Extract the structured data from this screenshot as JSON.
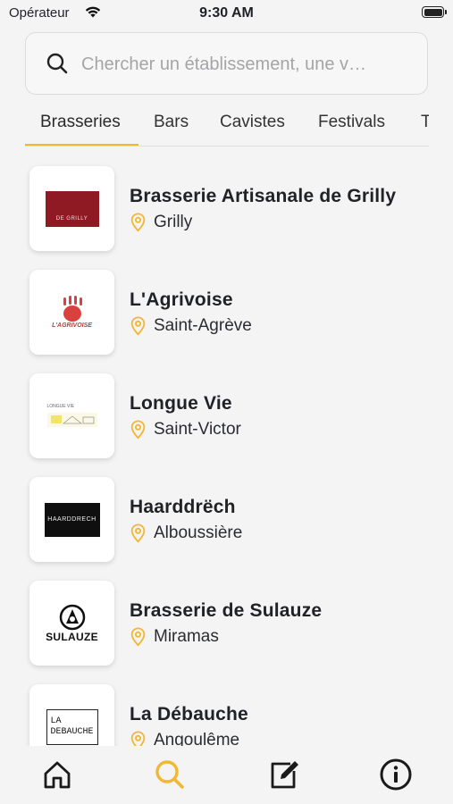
{
  "status": {
    "carrier": "Opérateur",
    "time": "9:30 AM"
  },
  "search": {
    "placeholder": "Chercher un établissement, une v…",
    "value": ""
  },
  "tabs": [
    "Brasseries",
    "Bars",
    "Cavistes",
    "Festivals",
    "T"
  ],
  "items": [
    {
      "name": "Brasserie Artisanale de Grilly",
      "location": "Grilly",
      "logo_text": "DE GRILLY"
    },
    {
      "name": "L'Agrivoise",
      "location": "Saint-Agrève",
      "logo_text": "L'AGRIVOISE"
    },
    {
      "name": "Longue Vie",
      "location": "Saint-Victor",
      "logo_text": "LONGUE VIE"
    },
    {
      "name": "Haarddrëch",
      "location": "Alboussière",
      "logo_text": "HAARDDRECH"
    },
    {
      "name": "Brasserie de Sulauze",
      "location": "Miramas",
      "logo_text": "SULAUZE"
    },
    {
      "name": "La Débauche",
      "location": "Angoulême",
      "logo_text_1": "LA",
      "logo_text_2": "DEBAUCHE"
    }
  ],
  "tabbar": [
    "home-icon",
    "search-icon",
    "edit-icon",
    "info-icon"
  ],
  "colors": {
    "accent": "#f2b733",
    "background": "#f4f4f5",
    "text": "#1f2126"
  }
}
